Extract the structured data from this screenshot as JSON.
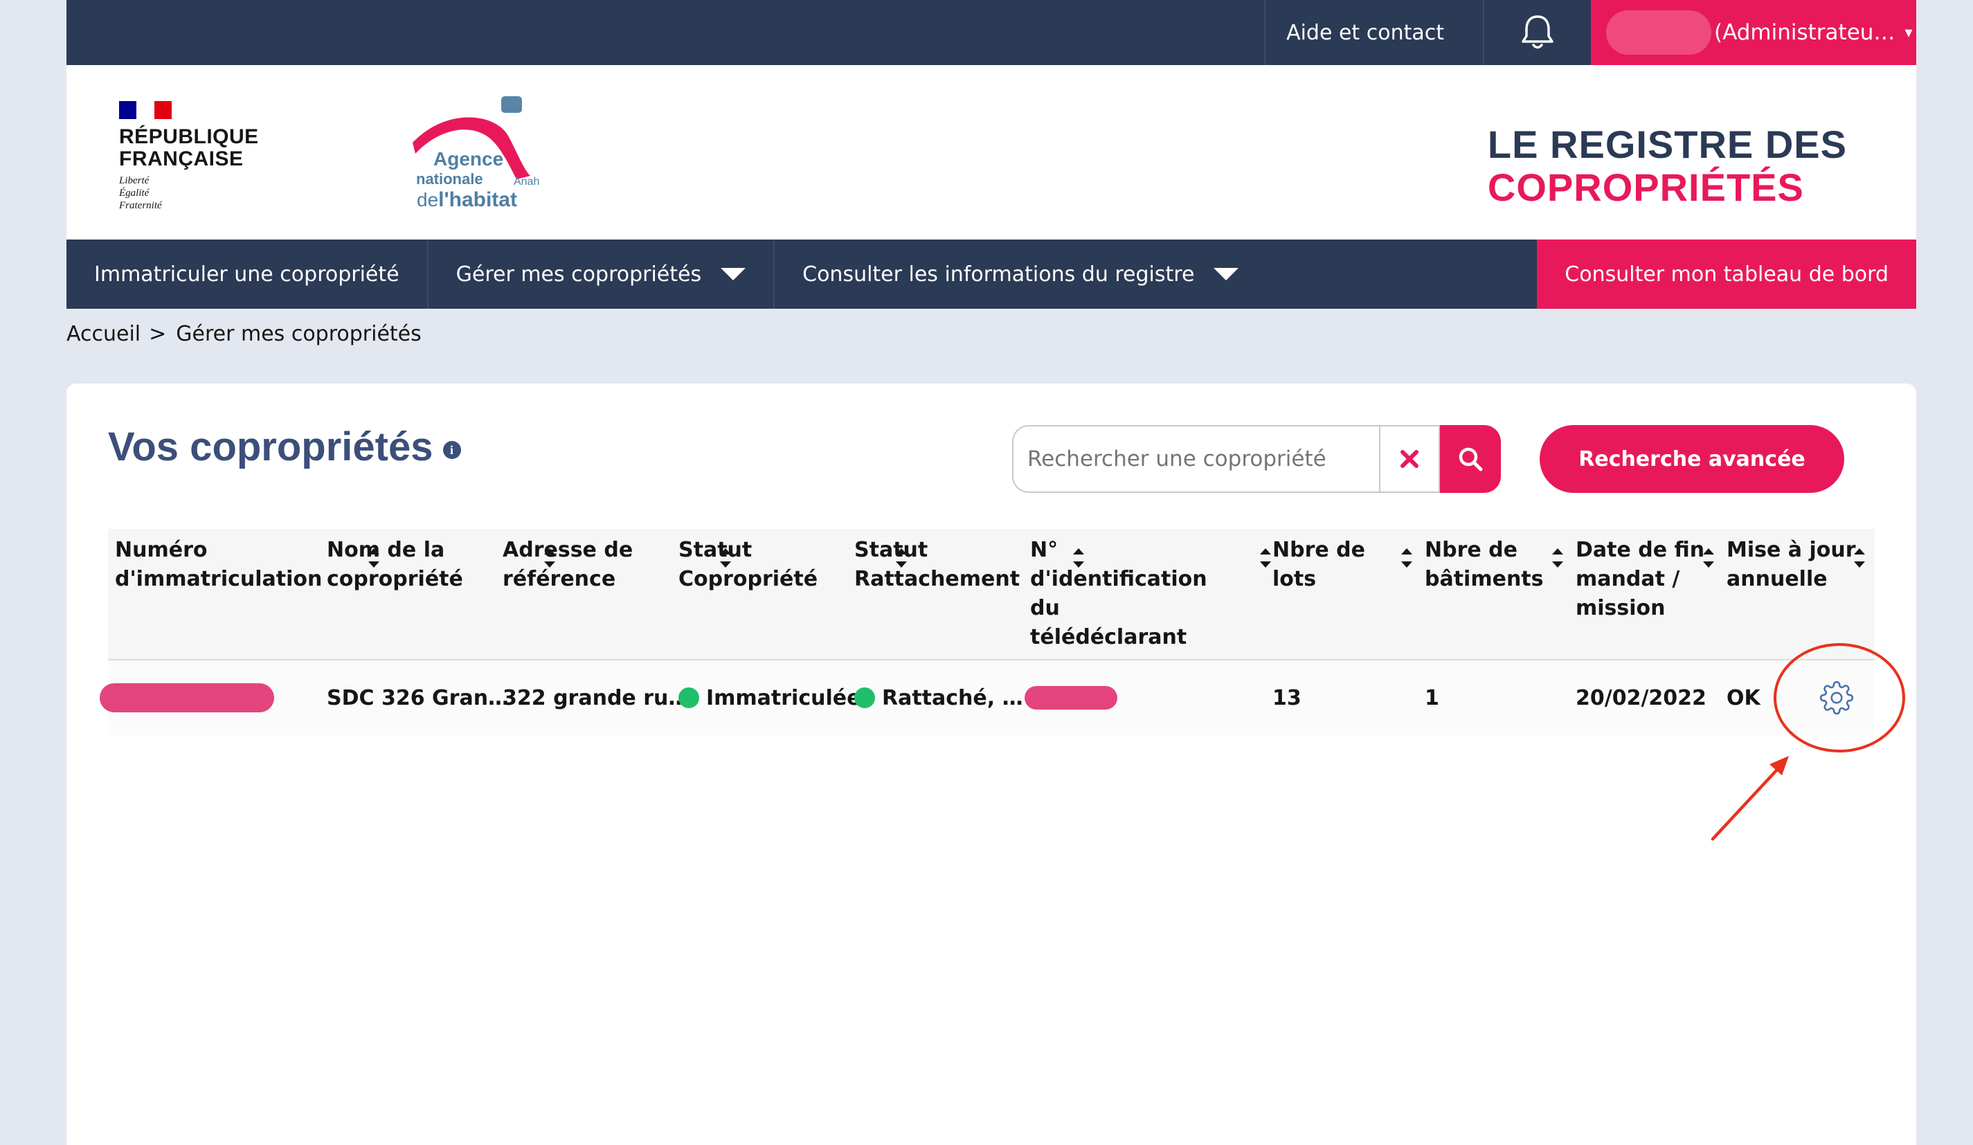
{
  "topbar": {
    "help_label": "Aide et contact",
    "user_label": "(Administrateu…"
  },
  "header": {
    "rf_name_line1": "RÉPUBLIQUE",
    "rf_name_line2": "FRANÇAISE",
    "rf_motto1": "Liberté",
    "rf_motto2": "Égalité",
    "rf_motto3": "Fraternité",
    "anah_agence": "Agence",
    "anah_nationale": "nationale",
    "anah_short": "Anah",
    "anah_de": "de",
    "anah_habitat": "l'habitat",
    "registre_line1": "LE REGISTRE DES",
    "registre_line2": "COPROPRIÉTÉS"
  },
  "nav": {
    "items": [
      {
        "label": "Immatriculer une copropriété"
      },
      {
        "label": "Gérer mes copropriétés"
      },
      {
        "label": "Consulter les informations du registre"
      }
    ],
    "dashboard_label": "Consulter mon tableau de bord"
  },
  "breadcrumb": {
    "home": "Accueil",
    "separator": ">",
    "current": "Gérer mes copropriétés"
  },
  "main": {
    "title": "Vos copropriétés",
    "info_glyph": "i",
    "search_placeholder": "Rechercher une copropriété",
    "advanced_label": "Recherche avancée"
  },
  "table": {
    "headers": [
      [
        "Numéro",
        "d'immatriculation"
      ],
      [
        "Nom de la",
        "copropriété"
      ],
      [
        "Adresse de",
        "référence"
      ],
      [
        "Statut",
        "Copropriété"
      ],
      [
        "Statut",
        "Rattachement"
      ],
      [
        "N°",
        "d'identification",
        "du",
        "télédéclarant"
      ],
      [
        "Nbre de",
        "lots"
      ],
      [
        "Nbre de",
        "bâtiments"
      ],
      [
        "Date de fin",
        "mandat /",
        "mission"
      ],
      [
        "Mise à jour",
        "annuelle"
      ]
    ],
    "row": {
      "nom": "SDC 326 Gran…",
      "adresse": "322 grande ru…",
      "statut_copro": "Immatriculée",
      "statut_rattachement": "Rattaché, …",
      "lots": "13",
      "batiments": "1",
      "date_fin": "20/02/2022",
      "maj": "OK"
    }
  },
  "colors": {
    "navy": "#2b3a55",
    "accent": "#e8195a",
    "status_green": "#1fbf6a",
    "annotation": "#e8321c"
  },
  "icons": [
    "bell-icon",
    "search-icon",
    "close-icon",
    "gear-icon",
    "info-icon",
    "chevron-down-icon"
  ]
}
